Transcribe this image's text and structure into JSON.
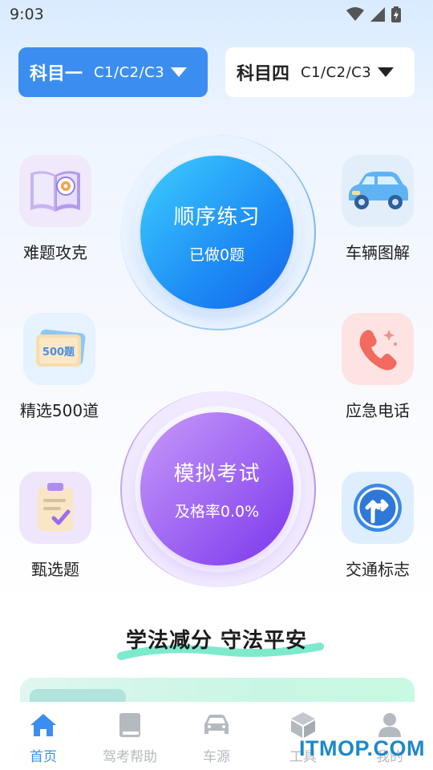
{
  "status_bar": {
    "time": "9:03"
  },
  "subjects": [
    {
      "title": "科目一",
      "type": "C1/C2/C3"
    },
    {
      "title": "科目四",
      "type": "C1/C2/C3"
    }
  ],
  "features": {
    "hard_questions": "难题攻克",
    "vehicle_diagrams": "车辆图解",
    "selected_500": "精选500道",
    "selected_500_badge": "500题",
    "emergency_call": "应急电话",
    "screening": "甄选题",
    "traffic_signs": "交通标志"
  },
  "practice": {
    "title": "顺序练习",
    "subtitle": "已做0题"
  },
  "exam": {
    "title": "模拟考试",
    "subtitle": "及格率0.0%"
  },
  "slogan": "学法减分 守法平安",
  "tabs": [
    {
      "label": "首页",
      "icon": "home-icon",
      "active": true
    },
    {
      "label": "驾考帮助",
      "icon": "book-icon",
      "active": false
    },
    {
      "label": "车源",
      "icon": "car-icon",
      "active": false
    },
    {
      "label": "工具",
      "icon": "box-icon",
      "active": false
    },
    {
      "label": "我的",
      "icon": "user-icon",
      "active": false
    }
  ],
  "watermark": "ITMOP.COM",
  "colors": {
    "accent": "#3b8ef0",
    "practice_blue": "#2196f3",
    "exam_purple": "#9b59f5"
  }
}
